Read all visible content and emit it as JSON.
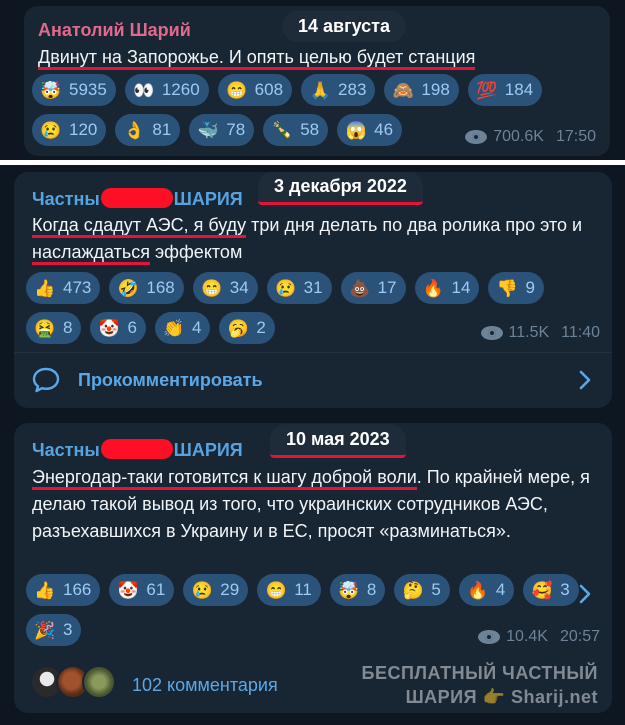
{
  "messages": [
    {
      "sender": "Анатолий Шарий",
      "date": "14 августа",
      "text": "Двинут на Запорожье. И опять целью будет станция",
      "reactions": [
        {
          "emoji": "🤯",
          "count": "5935"
        },
        {
          "emoji": "👀",
          "count": "1260"
        },
        {
          "emoji": "😁",
          "count": "608"
        },
        {
          "emoji": "🙏",
          "count": "283"
        },
        {
          "emoji": "🙈",
          "count": "198"
        },
        {
          "emoji": "💯",
          "count": "184"
        },
        {
          "emoji": "😢",
          "count": "120"
        },
        {
          "emoji": "👌",
          "count": "81"
        },
        {
          "emoji": "🐳",
          "count": "78"
        },
        {
          "emoji": "🍾",
          "count": "58"
        },
        {
          "emoji": "😱",
          "count": "46"
        }
      ],
      "views": "700.6K",
      "time": "17:50"
    },
    {
      "sender_prefix": "Частны",
      "sender_suffix": "ШАРИЯ",
      "date": "3 декабря 2022",
      "text_parts": [
        "Когда сдадут АЭС, я буду",
        " три дня делать по два ролика про это и ",
        "наслаждаться",
        " эффектом"
      ],
      "reactions": [
        {
          "emoji": "👍",
          "count": "473"
        },
        {
          "emoji": "🤣",
          "count": "168"
        },
        {
          "emoji": "😁",
          "count": "34"
        },
        {
          "emoji": "😢",
          "count": "31"
        },
        {
          "emoji": "💩",
          "count": "17"
        },
        {
          "emoji": "🔥",
          "count": "14"
        },
        {
          "emoji": "👎",
          "count": "9"
        },
        {
          "emoji": "🤮",
          "count": "8"
        },
        {
          "emoji": "🤡",
          "count": "6"
        },
        {
          "emoji": "👏",
          "count": "4"
        },
        {
          "emoji": "🥱",
          "count": "2"
        }
      ],
      "views": "11.5K",
      "time": "11:40",
      "comment_label": "Прокомментировать"
    },
    {
      "sender_prefix": "Частны",
      "sender_suffix": "ШАРИЯ",
      "date": "10 мая 2023",
      "text_parts": [
        "Энергодар-таки готовится к шагу доброй воли",
        ". По крайней мере, я делаю такой вывод из того, что украинских сотрудников АЭС, разъехавшихся в Украину и в ЕС, просят «разминаться»."
      ],
      "reactions": [
        {
          "emoji": "👍",
          "count": "166"
        },
        {
          "emoji": "🤡",
          "count": "61"
        },
        {
          "emoji": "😢",
          "count": "29"
        },
        {
          "emoji": "😁",
          "count": "11"
        },
        {
          "emoji": "🤯",
          "count": "8"
        },
        {
          "emoji": "🤔",
          "count": "5"
        },
        {
          "emoji": "🔥",
          "count": "4"
        },
        {
          "emoji": "🥰",
          "count": "3"
        },
        {
          "emoji": "🎉",
          "count": "3"
        }
      ],
      "views": "10.4K",
      "time": "20:57",
      "comments_count": "102 комментария",
      "watermark_line1": "БЕСПЛАТНЫЙ ЧАСТНЫЙ",
      "watermark_line2": "ШАРИЯ 👉 Sharij.net"
    }
  ],
  "colors": {
    "background": "#0e1621",
    "bubble": "#182533",
    "reaction_bg": "#2b5278",
    "accent_blue": "#5ba8e8",
    "sender_pink": "#e06a8b",
    "underline_red": "#e4133a"
  }
}
